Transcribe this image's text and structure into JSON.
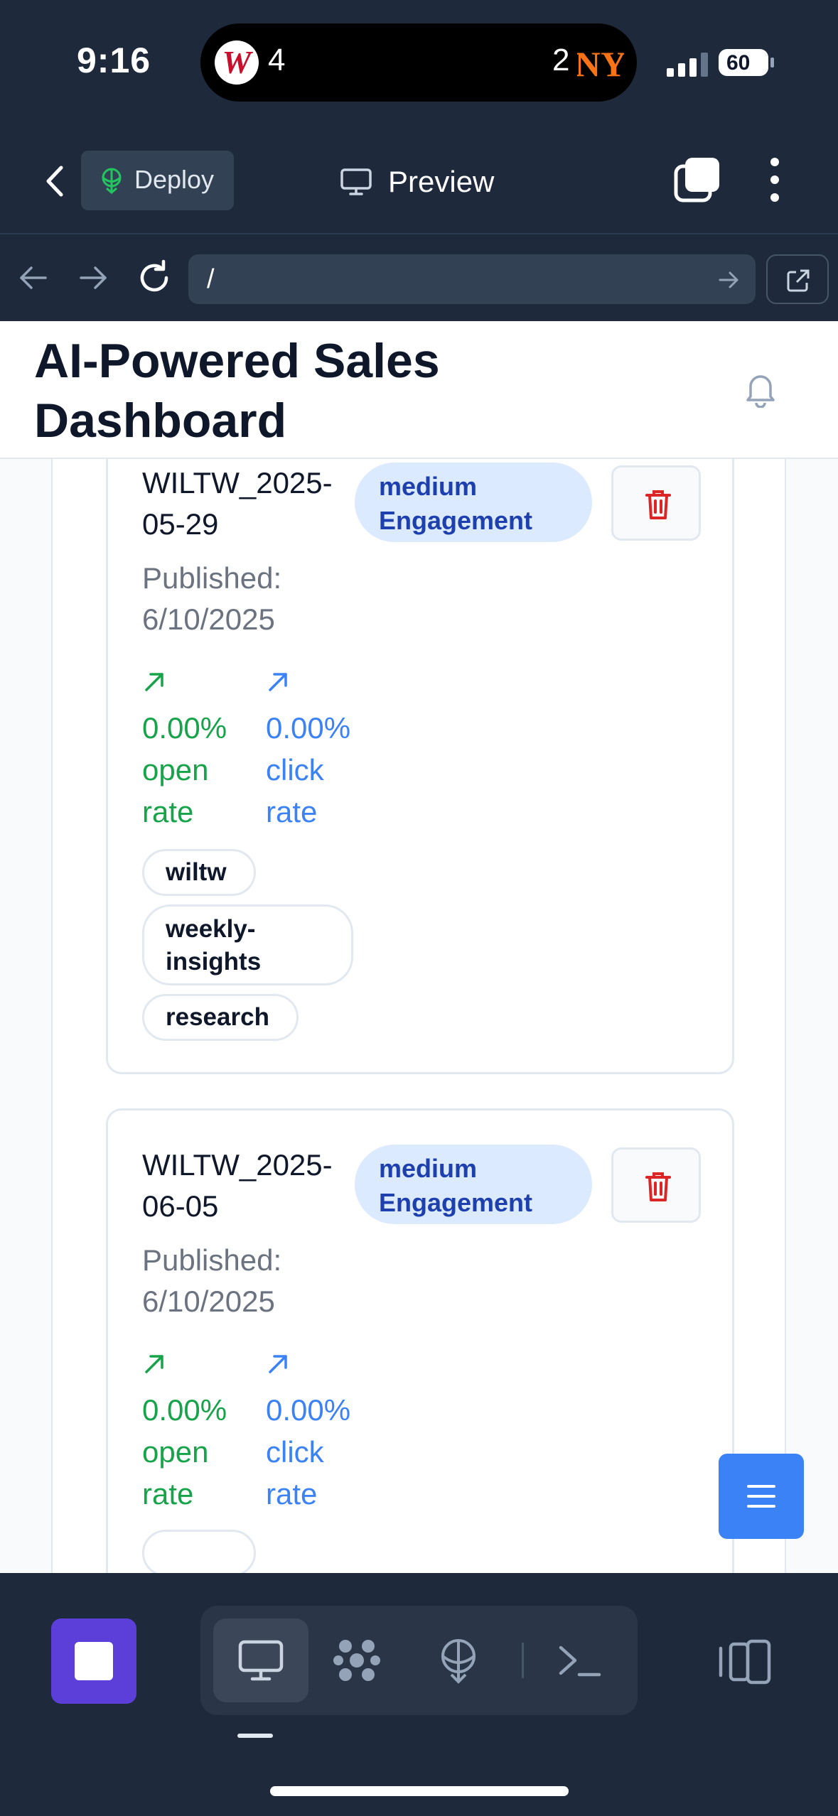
{
  "status_bar": {
    "time": "9:16",
    "score_left": "4",
    "score_right": "2",
    "battery": "60"
  },
  "toolbar": {
    "deploy_label": "Deploy",
    "preview_label": "Preview"
  },
  "address_bar": {
    "url": "/"
  },
  "app": {
    "title_line1": "AI-Powered Sales",
    "title_line2": "Dashboard"
  },
  "cards": [
    {
      "title_line1": "WILTW_2025-",
      "title_line2": "05-29",
      "badge_line1": "medium",
      "badge_line2": "Engagement",
      "published_label": "Published:",
      "published_date": "6/10/2025",
      "open_rate_value": "0.00%",
      "open_rate_line1": "open",
      "open_rate_line2": "rate",
      "click_rate_value": "0.00%",
      "click_rate_line1": "click",
      "click_rate_line2": "rate",
      "tags": [
        "wiltw",
        "weekly-",
        "insights",
        "research"
      ]
    },
    {
      "title_line1": "WILTW_2025-",
      "title_line2": "06-05",
      "badge_line1": "medium",
      "badge_line2": "Engagement",
      "published_label": "Published:",
      "published_date": "6/10/2025",
      "open_rate_value": "0.00%",
      "open_rate_line1": "open",
      "open_rate_line2": "rate",
      "click_rate_value": "0.00%",
      "click_rate_line1": "click",
      "click_rate_line2": "rate"
    }
  ],
  "colors": {
    "badge_bg": "#dbeafe",
    "badge_text": "#1e40af",
    "open_rate": "#16a34a",
    "click_rate": "#3b82f6",
    "delete": "#dc2626",
    "stop_button": "#5b3fd8",
    "fab": "#3b82f6"
  },
  "icons": [
    "back-icon",
    "deploy-icon",
    "monitor-icon",
    "tabs-icon",
    "more-vertical-icon",
    "arrow-left-icon",
    "arrow-right-icon",
    "reload-icon",
    "external-link-icon",
    "bell-icon",
    "trash-icon",
    "trend-up-icon",
    "menu-icon",
    "stop-icon",
    "nodes-icon",
    "terminal-icon",
    "panel-icon"
  ]
}
